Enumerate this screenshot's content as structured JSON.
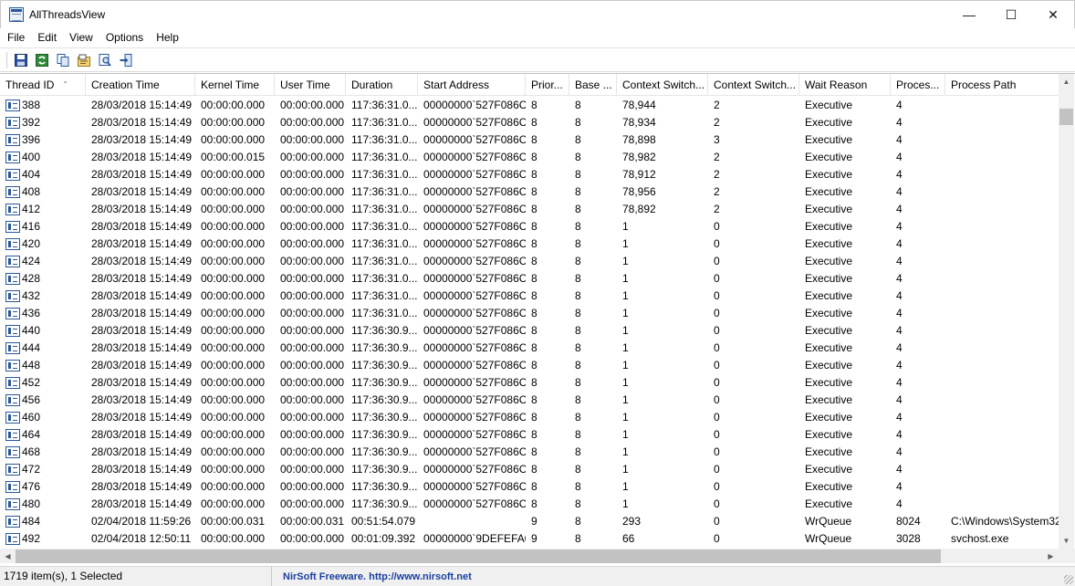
{
  "window": {
    "title": "AllThreadsView",
    "minimize_glyph": "—",
    "maximize_glyph": "☐",
    "close_glyph": "✕"
  },
  "menu": [
    "File",
    "Edit",
    "View",
    "Options",
    "Help"
  ],
  "toolbar": {
    "buttons": [
      "save-icon",
      "refresh-icon",
      "copy-icon",
      "properties-icon",
      "find-icon",
      "exit-icon"
    ]
  },
  "columns": [
    "Thread ID",
    "Creation Time",
    "Kernel Time",
    "User Time",
    "Duration",
    "Start Address",
    "Prior...",
    "Base ...",
    "Context Switch...",
    "Context Switch...",
    "Wait Reason",
    "Proces...",
    "Process Path"
  ],
  "sort_indicator": "⌃",
  "rows": [
    [
      "388",
      "28/03/2018 15:14:49",
      "00:00:00.000",
      "00:00:00.000",
      "117:36:31.0...",
      "00000000`527F086C",
      "8",
      "8",
      "78,944",
      "2",
      "Executive",
      "4",
      ""
    ],
    [
      "392",
      "28/03/2018 15:14:49",
      "00:00:00.000",
      "00:00:00.000",
      "117:36:31.0...",
      "00000000`527F086C",
      "8",
      "8",
      "78,934",
      "2",
      "Executive",
      "4",
      ""
    ],
    [
      "396",
      "28/03/2018 15:14:49",
      "00:00:00.000",
      "00:00:00.000",
      "117:36:31.0...",
      "00000000`527F086C",
      "8",
      "8",
      "78,898",
      "3",
      "Executive",
      "4",
      ""
    ],
    [
      "400",
      "28/03/2018 15:14:49",
      "00:00:00.015",
      "00:00:00.000",
      "117:36:31.0...",
      "00000000`527F086C",
      "8",
      "8",
      "78,982",
      "2",
      "Executive",
      "4",
      ""
    ],
    [
      "404",
      "28/03/2018 15:14:49",
      "00:00:00.000",
      "00:00:00.000",
      "117:36:31.0...",
      "00000000`527F086C",
      "8",
      "8",
      "78,912",
      "2",
      "Executive",
      "4",
      ""
    ],
    [
      "408",
      "28/03/2018 15:14:49",
      "00:00:00.000",
      "00:00:00.000",
      "117:36:31.0...",
      "00000000`527F086C",
      "8",
      "8",
      "78,956",
      "2",
      "Executive",
      "4",
      ""
    ],
    [
      "412",
      "28/03/2018 15:14:49",
      "00:00:00.000",
      "00:00:00.000",
      "117:36:31.0...",
      "00000000`527F086C",
      "8",
      "8",
      "78,892",
      "2",
      "Executive",
      "4",
      ""
    ],
    [
      "416",
      "28/03/2018 15:14:49",
      "00:00:00.000",
      "00:00:00.000",
      "117:36:31.0...",
      "00000000`527F086C",
      "8",
      "8",
      "1",
      "0",
      "Executive",
      "4",
      ""
    ],
    [
      "420",
      "28/03/2018 15:14:49",
      "00:00:00.000",
      "00:00:00.000",
      "117:36:31.0...",
      "00000000`527F086C",
      "8",
      "8",
      "1",
      "0",
      "Executive",
      "4",
      ""
    ],
    [
      "424",
      "28/03/2018 15:14:49",
      "00:00:00.000",
      "00:00:00.000",
      "117:36:31.0...",
      "00000000`527F086C",
      "8",
      "8",
      "1",
      "0",
      "Executive",
      "4",
      ""
    ],
    [
      "428",
      "28/03/2018 15:14:49",
      "00:00:00.000",
      "00:00:00.000",
      "117:36:31.0...",
      "00000000`527F086C",
      "8",
      "8",
      "1",
      "0",
      "Executive",
      "4",
      ""
    ],
    [
      "432",
      "28/03/2018 15:14:49",
      "00:00:00.000",
      "00:00:00.000",
      "117:36:31.0...",
      "00000000`527F086C",
      "8",
      "8",
      "1",
      "0",
      "Executive",
      "4",
      ""
    ],
    [
      "436",
      "28/03/2018 15:14:49",
      "00:00:00.000",
      "00:00:00.000",
      "117:36:31.0...",
      "00000000`527F086C",
      "8",
      "8",
      "1",
      "0",
      "Executive",
      "4",
      ""
    ],
    [
      "440",
      "28/03/2018 15:14:49",
      "00:00:00.000",
      "00:00:00.000",
      "117:36:30.9...",
      "00000000`527F086C",
      "8",
      "8",
      "1",
      "0",
      "Executive",
      "4",
      ""
    ],
    [
      "444",
      "28/03/2018 15:14:49",
      "00:00:00.000",
      "00:00:00.000",
      "117:36:30.9...",
      "00000000`527F086C",
      "8",
      "8",
      "1",
      "0",
      "Executive",
      "4",
      ""
    ],
    [
      "448",
      "28/03/2018 15:14:49",
      "00:00:00.000",
      "00:00:00.000",
      "117:36:30.9...",
      "00000000`527F086C",
      "8",
      "8",
      "1",
      "0",
      "Executive",
      "4",
      ""
    ],
    [
      "452",
      "28/03/2018 15:14:49",
      "00:00:00.000",
      "00:00:00.000",
      "117:36:30.9...",
      "00000000`527F086C",
      "8",
      "8",
      "1",
      "0",
      "Executive",
      "4",
      ""
    ],
    [
      "456",
      "28/03/2018 15:14:49",
      "00:00:00.000",
      "00:00:00.000",
      "117:36:30.9...",
      "00000000`527F086C",
      "8",
      "8",
      "1",
      "0",
      "Executive",
      "4",
      ""
    ],
    [
      "460",
      "28/03/2018 15:14:49",
      "00:00:00.000",
      "00:00:00.000",
      "117:36:30.9...",
      "00000000`527F086C",
      "8",
      "8",
      "1",
      "0",
      "Executive",
      "4",
      ""
    ],
    [
      "464",
      "28/03/2018 15:14:49",
      "00:00:00.000",
      "00:00:00.000",
      "117:36:30.9...",
      "00000000`527F086C",
      "8",
      "8",
      "1",
      "0",
      "Executive",
      "4",
      ""
    ],
    [
      "468",
      "28/03/2018 15:14:49",
      "00:00:00.000",
      "00:00:00.000",
      "117:36:30.9...",
      "00000000`527F086C",
      "8",
      "8",
      "1",
      "0",
      "Executive",
      "4",
      ""
    ],
    [
      "472",
      "28/03/2018 15:14:49",
      "00:00:00.000",
      "00:00:00.000",
      "117:36:30.9...",
      "00000000`527F086C",
      "8",
      "8",
      "1",
      "0",
      "Executive",
      "4",
      ""
    ],
    [
      "476",
      "28/03/2018 15:14:49",
      "00:00:00.000",
      "00:00:00.000",
      "117:36:30.9...",
      "00000000`527F086C",
      "8",
      "8",
      "1",
      "0",
      "Executive",
      "4",
      ""
    ],
    [
      "480",
      "28/03/2018 15:14:49",
      "00:00:00.000",
      "00:00:00.000",
      "117:36:30.9...",
      "00000000`527F086C",
      "8",
      "8",
      "1",
      "0",
      "Executive",
      "4",
      ""
    ],
    [
      "484",
      "02/04/2018 11:59:26",
      "00:00:00.031",
      "00:00:00.031",
      "00:51:54.079",
      "",
      "9",
      "8",
      "293",
      "0",
      "WrQueue",
      "8024",
      "C:\\Windows\\System32"
    ],
    [
      "492",
      "02/04/2018 12:50:11",
      "00:00:00.000",
      "00:00:00.000",
      "00:01:09.392",
      "00000000`9DEFEFA0",
      "9",
      "8",
      "66",
      "0",
      "WrQueue",
      "3028",
      "svchost.exe"
    ]
  ],
  "scroll_arrows": {
    "up": "▲",
    "down": "▼",
    "left": "◀",
    "right": "▶"
  },
  "status": {
    "items": "1719 item(s), 1 Selected",
    "link": "NirSoft Freeware.  http://www.nirsoft.net"
  }
}
